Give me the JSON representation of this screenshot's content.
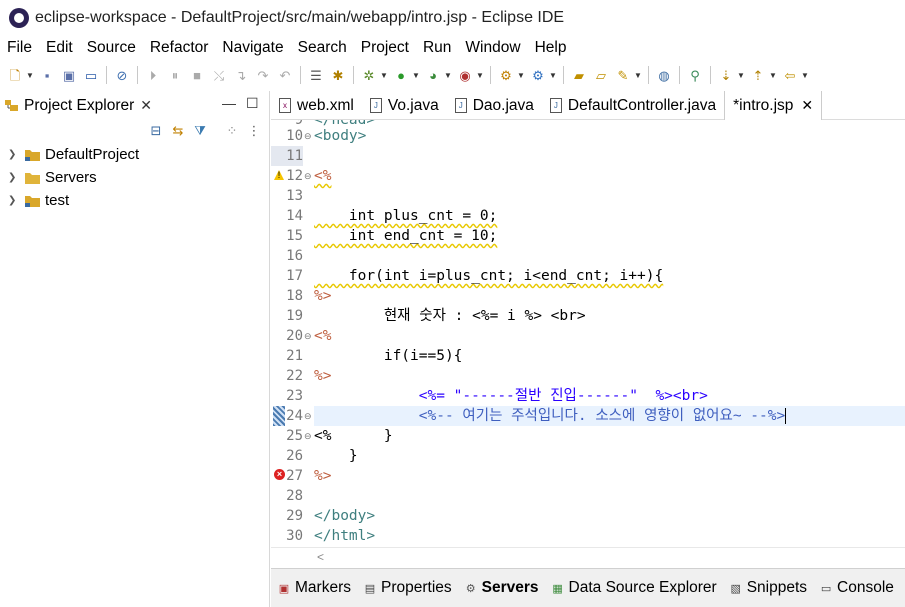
{
  "window": {
    "title": "eclipse-workspace - DefaultProject/src/main/webapp/intro.jsp - Eclipse IDE"
  },
  "menu": [
    "File",
    "Edit",
    "Source",
    "Refactor",
    "Navigate",
    "Search",
    "Project",
    "Run",
    "Window",
    "Help"
  ],
  "explorer": {
    "tab_label": "Project Explorer",
    "close": "✕",
    "minimize": "—",
    "maximize": "☐",
    "items": [
      {
        "label": "DefaultProject",
        "icon": "project-icon"
      },
      {
        "label": "Servers",
        "icon": "folder-icon"
      },
      {
        "label": "test",
        "icon": "project-icon"
      }
    ]
  },
  "editor_tabs": [
    {
      "label": "web.xml",
      "icon": "xml-file-icon"
    },
    {
      "label": "Vo.java",
      "icon": "java-file-icon"
    },
    {
      "label": "Dao.java",
      "icon": "java-file-icon"
    },
    {
      "label": "DefaultController.java",
      "icon": "java-file-icon"
    },
    {
      "label": "*intro.jsp",
      "icon": "jsp-file-icon",
      "active": true,
      "close": "✕"
    }
  ],
  "code": {
    "top_partial": "</head>",
    "lines": [
      {
        "n": "10",
        "text": "<body>"
      },
      {
        "n": "11",
        "text": ""
      },
      {
        "n": "12",
        "text": "<%"
      },
      {
        "n": "13",
        "text": ""
      },
      {
        "n": "14",
        "text": "    int plus_cnt = 0;"
      },
      {
        "n": "15",
        "text": "    int end_cnt = 10;"
      },
      {
        "n": "16",
        "text": ""
      },
      {
        "n": "17",
        "text": "    for(int i=plus_cnt; i<end_cnt; i++){"
      },
      {
        "n": "18",
        "text": "%>"
      },
      {
        "n": "19",
        "text": "        현재 숫자 : <%= i %> <br>"
      },
      {
        "n": "20",
        "text": "<%"
      },
      {
        "n": "21",
        "text": "        if(i==5){"
      },
      {
        "n": "22",
        "text": "%>"
      },
      {
        "n": "23",
        "text": "            <%= \"------절반 진입------\"  %><br>"
      },
      {
        "n": "24",
        "text": "            <%-- 여기는 주석입니다. 소스에 영향이 없어요~ --%>"
      },
      {
        "n": "25",
        "text": "<%      }"
      },
      {
        "n": "26",
        "text": "    }"
      },
      {
        "n": "27",
        "text": "%>"
      },
      {
        "n": "28",
        "text": ""
      },
      {
        "n": "29",
        "text": "</body>"
      },
      {
        "n": "30",
        "text": "</html>"
      }
    ]
  },
  "bottom_tabs": [
    {
      "label": "Markers",
      "icon": "markers-icon"
    },
    {
      "label": "Properties",
      "icon": "properties-icon"
    },
    {
      "label": "Servers",
      "icon": "servers-icon",
      "active": true
    },
    {
      "label": "Data Source Explorer",
      "icon": "data-source-icon"
    },
    {
      "label": "Snippets",
      "icon": "snippets-icon"
    },
    {
      "label": "Console",
      "icon": "console-icon"
    }
  ]
}
